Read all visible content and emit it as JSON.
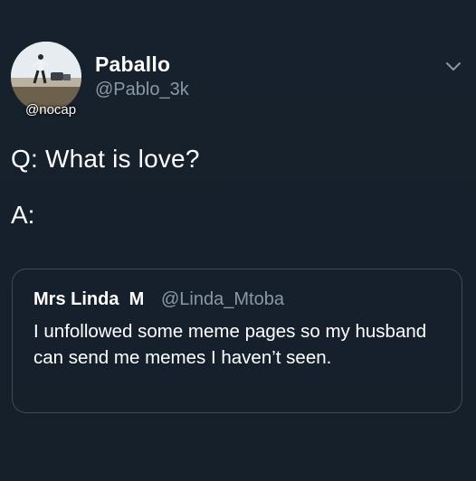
{
  "author": {
    "display_name": "Paballo",
    "handle": "@Pablo_3k",
    "avatar_watermark": "@nocap"
  },
  "tweet": {
    "question": "Q: What is love?",
    "answer": "A:"
  },
  "quoted_tweet": {
    "display_name": "Mrs Linda  M",
    "handle": "@Linda_Mtoba",
    "text": "I unfollowed some meme pages so my husband can send me memes I haven’t seen."
  },
  "icons": {
    "menu": "chevron-down-icon"
  },
  "colors": {
    "background": "#16202c",
    "secondary_text": "#8899a6",
    "border": "#3d4a57"
  }
}
